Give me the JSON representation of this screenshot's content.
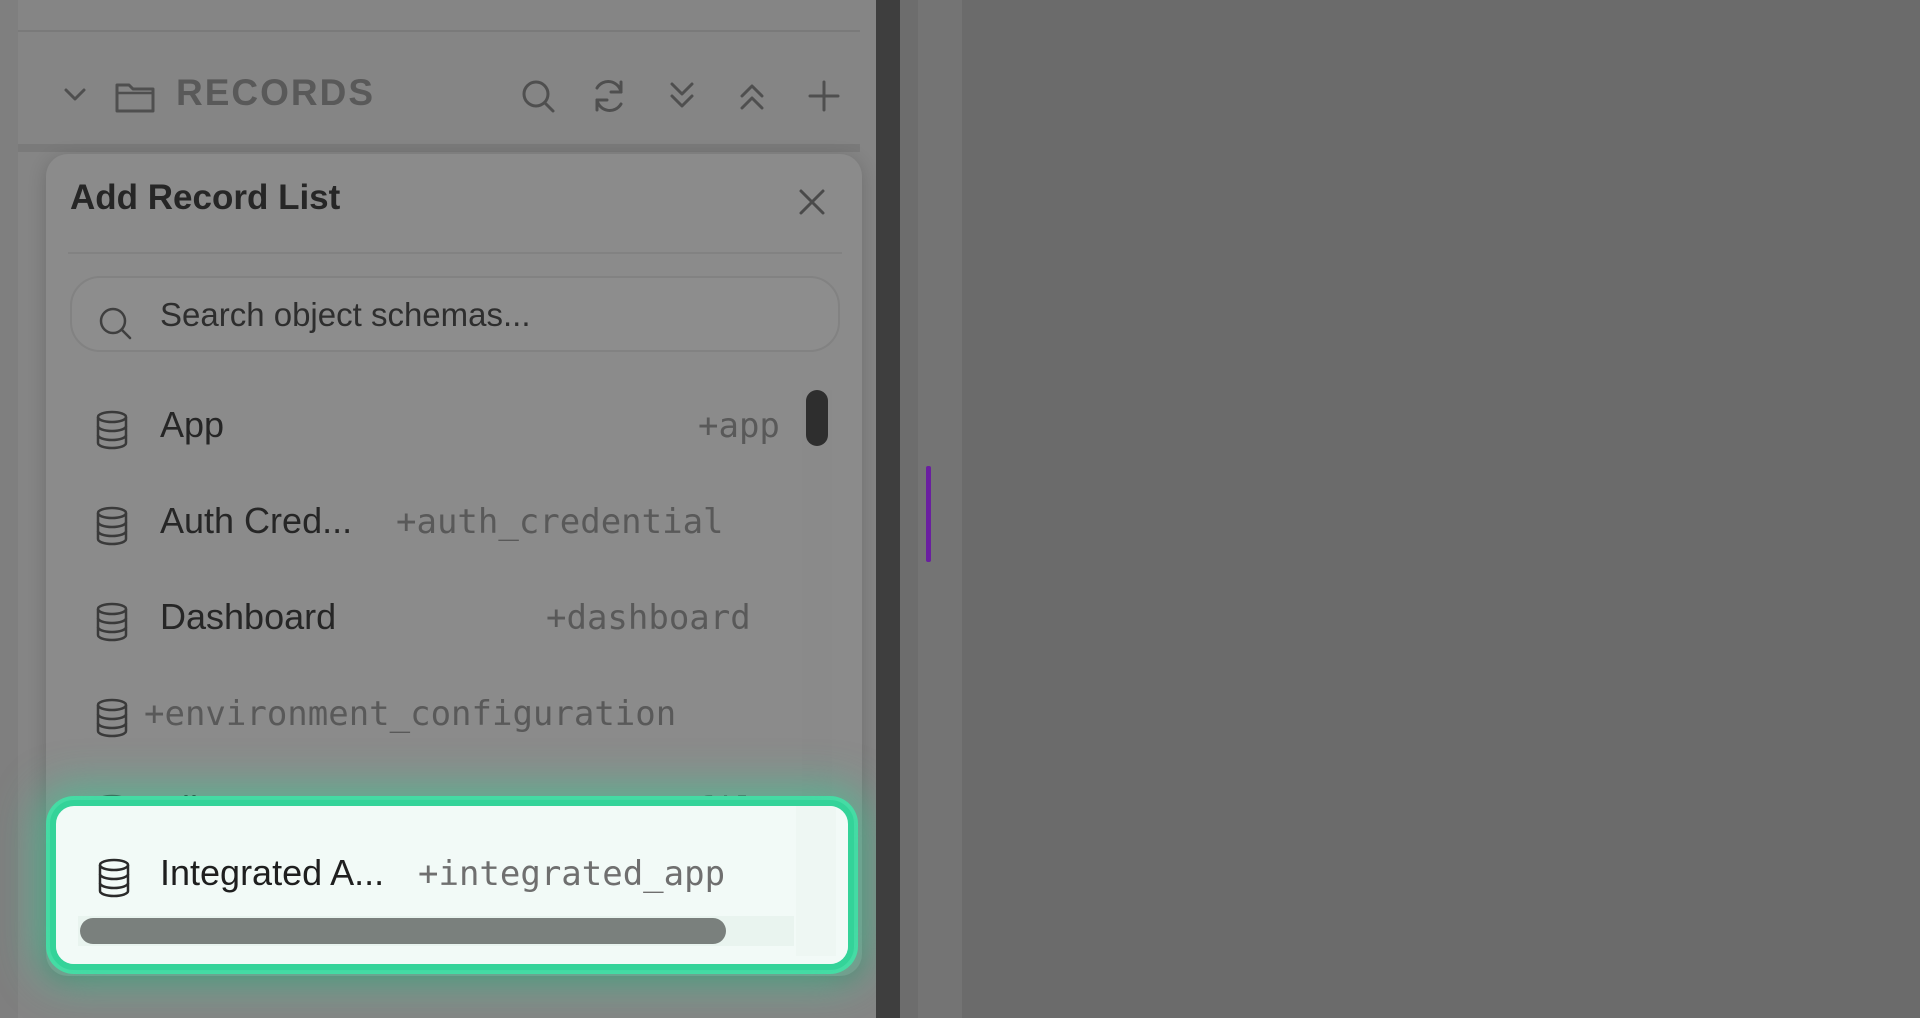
{
  "sidebar": {
    "section_title": "RECORDS",
    "icons": [
      "chevron-down-icon",
      "folder-icon",
      "search-icon",
      "refresh-icon",
      "expand-all-icon",
      "collapse-all-icon",
      "plus-icon"
    ]
  },
  "popup": {
    "title": "Add Record List",
    "search": {
      "placeholder": "Search object schemas...",
      "value": ""
    },
    "items": [
      {
        "name": "App",
        "key": "+app"
      },
      {
        "name": "Auth Cred...",
        "key": "+auth_credential"
      },
      {
        "name": "Dashboard",
        "key": "+dashboard"
      },
      {
        "name": "",
        "key": "+environment_configuration"
      },
      {
        "name": "File",
        "key": "+file"
      },
      {
        "name": "Integrated A...",
        "key": "+integrated_app"
      }
    ]
  },
  "colors": {
    "highlight_border": "#34d399",
    "marker": "#6a1fa0"
  }
}
